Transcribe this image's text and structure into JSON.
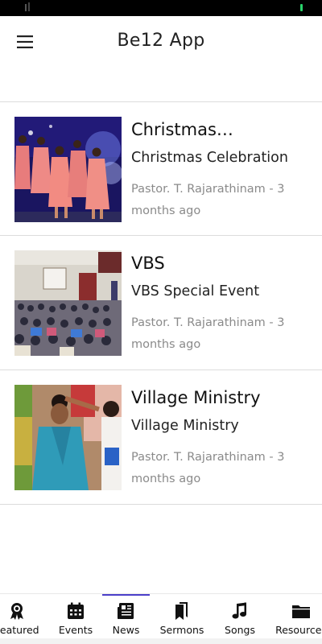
{
  "app": {
    "title": "Be12 App"
  },
  "news": [
    {
      "title": "Christmas…",
      "subtitle": "Christmas Celebration",
      "meta": "Pastor. T. Rajarathinam - 3 months ago",
      "image": "children-dancing-photo"
    },
    {
      "title": "VBS",
      "subtitle": "VBS Special Event",
      "meta": "Pastor. T. Rajarathinam - 3 months ago",
      "image": "hall-gathering-photo"
    },
    {
      "title": "Village Ministry",
      "subtitle": "Village Ministry",
      "meta": "Pastor. T. Rajarathinam - 3 months ago",
      "image": "prayer-photo"
    }
  ],
  "nav": {
    "active": "News",
    "items": [
      {
        "label": "Featured",
        "icon": "award-icon"
      },
      {
        "label": "Events",
        "icon": "calendar-icon"
      },
      {
        "label": "News",
        "icon": "newspaper-icon"
      },
      {
        "label": "Sermons",
        "icon": "bookmarks-icon"
      },
      {
        "label": "Songs",
        "icon": "music-note-icon"
      },
      {
        "label": "Resources",
        "icon": "folder-icon"
      }
    ]
  },
  "colors": {
    "accent": "#4b3fc9",
    "divider": "#dcdcdc",
    "meta_text": "#8a8a8a"
  }
}
